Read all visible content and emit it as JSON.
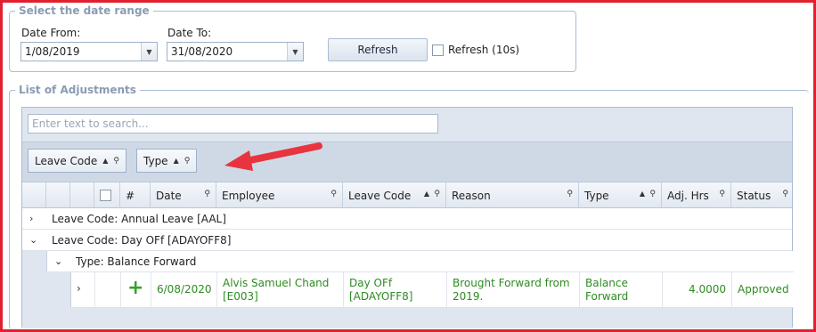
{
  "date_range": {
    "legend": "Select the date range",
    "from_label": "Date From:",
    "from_value": "1/08/2019",
    "to_label": "Date To:",
    "to_value": "31/08/2020",
    "refresh_label": "Refresh",
    "auto_refresh_label": "Refresh (10s)"
  },
  "adjustments": {
    "legend": "List of Adjustments",
    "search_placeholder": "Enter text to search...",
    "group_chips": [
      "Leave Code",
      "Type"
    ],
    "columns": {
      "select": "",
      "num": "#",
      "date": "Date",
      "employee": "Employee",
      "leave_code": "Leave Code",
      "reason": "Reason",
      "type": "Type",
      "adj_hrs": "Adj. Hrs",
      "status": "Status"
    },
    "groups": [
      {
        "label": "Leave Code: Annual Leave [AAL]"
      },
      {
        "label": "Leave Code: Day OFf [ADAYOFF8]"
      }
    ],
    "subgroup": {
      "label": "Type: Balance Forward"
    },
    "row": {
      "date": "6/08/2020",
      "employee_line1": "Alvis Samuel Chand",
      "employee_line2": "[E003]",
      "leave_code_line1": "Day OFf",
      "leave_code_line2": "[ADAYOFF8]",
      "reason_line1": "Brought Forward from",
      "reason_line2": "2019.",
      "type_line1": "Balance",
      "type_line2": "Forward",
      "adj_hrs": "4.0000",
      "status": "Approved"
    }
  },
  "colors": {
    "frame": "#e0202e",
    "annotation_arrow": "#e8343f",
    "approved_text": "#2e8b22"
  }
}
